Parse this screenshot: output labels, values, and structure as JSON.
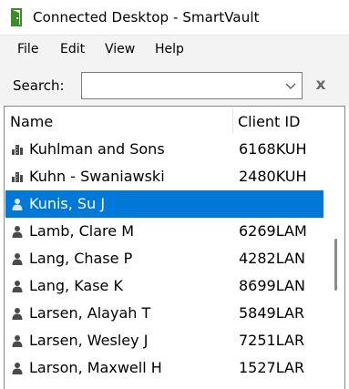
{
  "window": {
    "title": "Connected Desktop - SmartVault",
    "app_icon": "smartvault-door-icon"
  },
  "menu": {
    "items": [
      {
        "label": "File"
      },
      {
        "label": "Edit"
      },
      {
        "label": "View"
      },
      {
        "label": "Help"
      }
    ]
  },
  "search": {
    "label": "Search:",
    "value": "",
    "clear_label": "x"
  },
  "list": {
    "columns": {
      "name": "Name",
      "client_id": "Client ID"
    },
    "rows": [
      {
        "name": "Kuhlman and Sons",
        "client_id": "6168KUH",
        "icon": "company-icon",
        "selected": false
      },
      {
        "name": "Kuhn - Swaniawski",
        "client_id": "2480KUH",
        "icon": "company-icon",
        "selected": false
      },
      {
        "name": "Kunis, Su J",
        "client_id": "",
        "icon": "person-icon",
        "selected": true
      },
      {
        "name": "Lamb, Clare M",
        "client_id": "6269LAM",
        "icon": "person-icon",
        "selected": false
      },
      {
        "name": "Lang, Chase P",
        "client_id": "4282LAN",
        "icon": "person-icon",
        "selected": false
      },
      {
        "name": "Lang, Kase K",
        "client_id": "8699LAN",
        "icon": "person-icon",
        "selected": false
      },
      {
        "name": "Larsen, Alayah T",
        "client_id": "5849LAR",
        "icon": "person-icon",
        "selected": false
      },
      {
        "name": "Larsen, Wesley J",
        "client_id": "7251LAR",
        "icon": "person-icon",
        "selected": false
      },
      {
        "name": "Larson, Maxwell H",
        "client_id": "1527LAR",
        "icon": "person-icon",
        "selected": false
      }
    ]
  },
  "colors": {
    "selection": "#0078d7",
    "icon_gray": "#4a4a4a",
    "brand_green": "#3c8c28"
  }
}
